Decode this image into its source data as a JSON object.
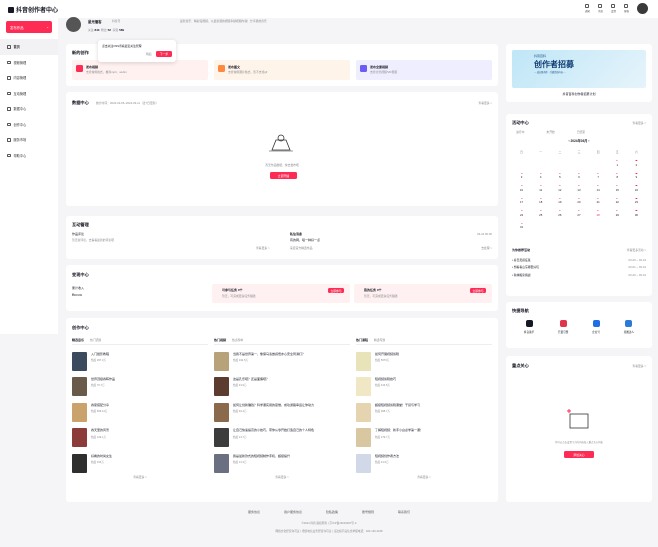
{
  "app": {
    "title": "抖音创作者中心"
  },
  "header": {
    "icons": [
      "通知",
      "消息",
      "设置",
      "客服"
    ]
  },
  "sidebar": {
    "publish": "发布作品",
    "items": [
      {
        "label": "首页"
      },
      {
        "label": "视频管理"
      },
      {
        "label": "内容管理"
      },
      {
        "label": "互动管理"
      },
      {
        "label": "数据中心"
      },
      {
        "label": "创作中心"
      },
      {
        "label": "服务市场"
      },
      {
        "label": "帮助中心"
      }
    ]
  },
  "profile": {
    "name": "星光播客",
    "tag": "抖音号",
    "follow_label": "关注",
    "follow": "843",
    "fans_label": "粉丝",
    "fans": "52",
    "likes_label": "获赞",
    "likes": "589",
    "bio": "最新音乐、精彩短视频，以最新潮的视频奉献视频内容！分享我的音乐"
  },
  "popup": {
    "text": "点击关注OSS查看最近关注管理",
    "later": "稍后",
    "next": "下一步"
  },
  "new_creation": {
    "title": "新的创作",
    "items": [
      {
        "title": "发布视频",
        "sub": "支持常用格式，推荐mp4、webm"
      },
      {
        "title": "发布图文",
        "sub": "支持常用图片格式，暂不支持gif"
      },
      {
        "title": "发布全景视频",
        "sub": "支持全景视频/VR视频"
      }
    ]
  },
  "data_center": {
    "title": "数据中心",
    "range": "统计时间：2024-03-05~2024-03-11（近7日更新）",
    "more": "查看更多 >",
    "empty": "暂无作品数据，快去发布吧",
    "button": "立即开播"
  },
  "interaction": {
    "title": "互动管理",
    "left": {
      "label": "作品评论",
      "sub": "暂无新评论，去看看最新的评论吧",
      "link": "查看更多 >"
    },
    "right": {
      "label": "私信消息",
      "user": "有的网，喂一种好一点",
      "date": "03-24 00:00",
      "sub": "来自官方精选作品",
      "link": "去处理 >"
    }
  },
  "monetize": {
    "title": "变现中心",
    "left": {
      "label": "累计收入",
      "value": "¥•••••••"
    },
    "mid": {
      "title": "可参与任务 0个",
      "sub": "暂无，可完成更多任务赚钱",
      "btn": "立即参与"
    },
    "right": {
      "title": "我的任务 0个",
      "sub": "暂无，可完成更多任务赚钱",
      "btn": "立即参与"
    }
  },
  "creation_center": {
    "title": "创作中心",
    "tabs1": [
      "精选音乐",
      "热门话题"
    ],
    "col1": [
      {
        "t": "入门摄影教程",
        "s": "热度 297.3万"
      },
      {
        "t": "世界顶级春晖作品",
        "s": "热度 76.7万"
      },
      {
        "t": "春夏搭配分享",
        "s": "热度 669.14万"
      },
      {
        "t": "春天里的风景",
        "s": "热度 129.1万"
      },
      {
        "t": "好看的时尚女生",
        "s": "热度 163万"
      }
    ],
    "tabs2": [
      "热门视频",
      "热点榜单"
    ],
    "col2": [
      {
        "t": "当我不是世界第一，像保马凑嵌感悟亦心安全局满打？",
        "s": "热度 192.5万"
      },
      {
        "t": "这是孔乐吧？还是面瘫吧？",
        "s": "热度 43.9万"
      },
      {
        "t": "如何让创新赚钱？科学课实用的思维，成功通路幸运让你动力",
        "s": "热度 94.4万"
      },
      {
        "t": "让自己快速提高的小技巧，带你从零开始打造自己的个人特色",
        "s": "热度 13.7万"
      },
      {
        "t": "我是最新款式的短视频制作手机，超级提升",
        "s": "热度 13.4万"
      }
    ],
    "tabs3": [
      "热门课程",
      "精选专题"
    ],
    "col3": [
      {
        "t": "如何开展视频剪辑",
        "s": "热度 5670万"
      },
      {
        "t": "短视频剪辑技巧",
        "s": "热度 443.8万"
      },
      {
        "t": "超级短视频剪辑课堂！干货与学习",
        "s": "热度 398.7万"
      },
      {
        "t": "了解短视频：新手小白必学第一课！",
        "s": "热度 279.7万"
      },
      {
        "t": "短视频创作者方法",
        "s": "热度 44.6万"
      }
    ],
    "more": [
      "查看更多 >",
      "查看更多 >",
      "查看更多 >"
    ]
  },
  "banner": {
    "small": "抖音百科",
    "title": "创作者招募",
    "sub": "— 成长路有你 · 共建优质内容 —",
    "caption": "抖音百科创作者招募计划"
  },
  "activity": {
    "title": "活动中心",
    "more": "查看更多 >",
    "legend": [
      "进行中",
      "未开始",
      "已结束"
    ],
    "month": "2024年03月",
    "weekdays": [
      "日",
      "一",
      "二",
      "三",
      "四",
      "五",
      "六"
    ],
    "days": [
      "",
      "",
      "",
      "",
      "",
      "1",
      "2",
      "3",
      "4",
      "5",
      "6",
      "7",
      "8",
      "9",
      "10",
      "11",
      "12",
      "13",
      "14",
      "15",
      "16",
      "17",
      "18",
      "19",
      "20",
      "21",
      "22",
      "23",
      "24",
      "25",
      "26",
      "27",
      "28",
      "29",
      "30",
      "31",
      "",
      "",
      "",
      "",
      "",
      ""
    ],
    "today": "28",
    "rec_title": "为你推荐活动",
    "rec_more": "查看更多活动 >",
    "list": [
      {
        "t": "• 春日灵感征集",
        "d": "03-20 ~ 03-31"
      },
      {
        "t": "• 想看看山东哪里好玩",
        "d": "03-01 ~ 03-31"
      },
      {
        "t": "• 秋林搬家挑战",
        "d": "03-20 ~ 03-31"
      }
    ]
  },
  "quick": {
    "title": "快捷导航",
    "items": [
      "抖音助手",
      "巨量引擎",
      "企业号",
      "星图达人"
    ]
  },
  "focus": {
    "title": "重点关心",
    "more": "查看更多 >",
    "empty": "你可以点击设置下方的内容加入重点关心列表",
    "btn": "添加关心"
  },
  "footer": {
    "links": [
      "服务协议",
      "用户服务协议",
      "隐私政策",
      "账号规则",
      "联系我们"
    ],
    "line1": "©2024 抖音 版权所有 | 京ICP备16016397号-3",
    "line2": "网络文化经营许可证 | 增值电信业务经营许可证 | 违法和不良信息举报电话：400-140-2108"
  },
  "colors": {
    "accent": "#fe2c55",
    "bg": "#f5f5f7"
  }
}
